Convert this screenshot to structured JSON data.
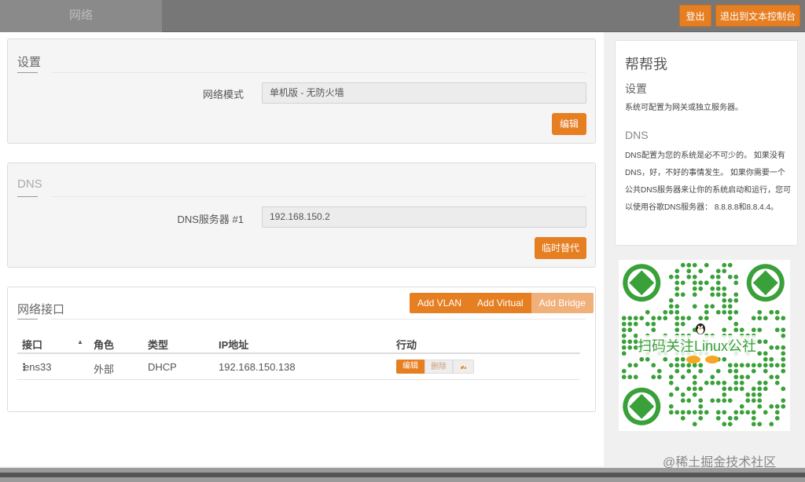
{
  "topbar": {
    "tab_label": "网络",
    "login_label": "登出",
    "console_label": "退出到文本控制台"
  },
  "settings": {
    "title": "设置",
    "mode_label": "网络模式",
    "mode_value": "单机版 - 无防火墙",
    "edit_label": "编辑"
  },
  "dns": {
    "title": "DNS",
    "server_label": "DNS服务器 #1",
    "server_value": "192.168.150.2",
    "override_label": "临时替代"
  },
  "interfaces": {
    "title": "网络接口",
    "add_vlan": "Add VLAN",
    "add_virtual": "Add Virtual",
    "add_bridge": "Add Bridge",
    "columns": [
      "接口",
      "角色",
      "类型",
      "IP地址",
      "行动"
    ],
    "rows": [
      {
        "interface": "ens33",
        "role": "外部",
        "type": "DHCP",
        "ip": "192.168.150.138",
        "edit": "编辑",
        "delete": "删除"
      }
    ]
  },
  "help": {
    "title": "帮帮我",
    "settings_heading": "设置",
    "settings_text": "系统可配置为网关或独立服务器。",
    "dns_heading": "DNS",
    "dns_text": "DNS配置为您的系统是必不可少的。 如果没有DNS，好，不好的事情发生。 如果你需要一个公共DNS服务器来让你的系统启动和运行，您可以使用谷歌DNS服务器： 8.8.8.8和8.8.4.4。"
  },
  "qr": {
    "caption": "扫码关注Linux公社"
  },
  "watermark": "@稀土掘金技术社区",
  "colors": {
    "accent": "#e67e22",
    "accent_light": "#f0b07a",
    "qr_green": "#3aa03a"
  }
}
